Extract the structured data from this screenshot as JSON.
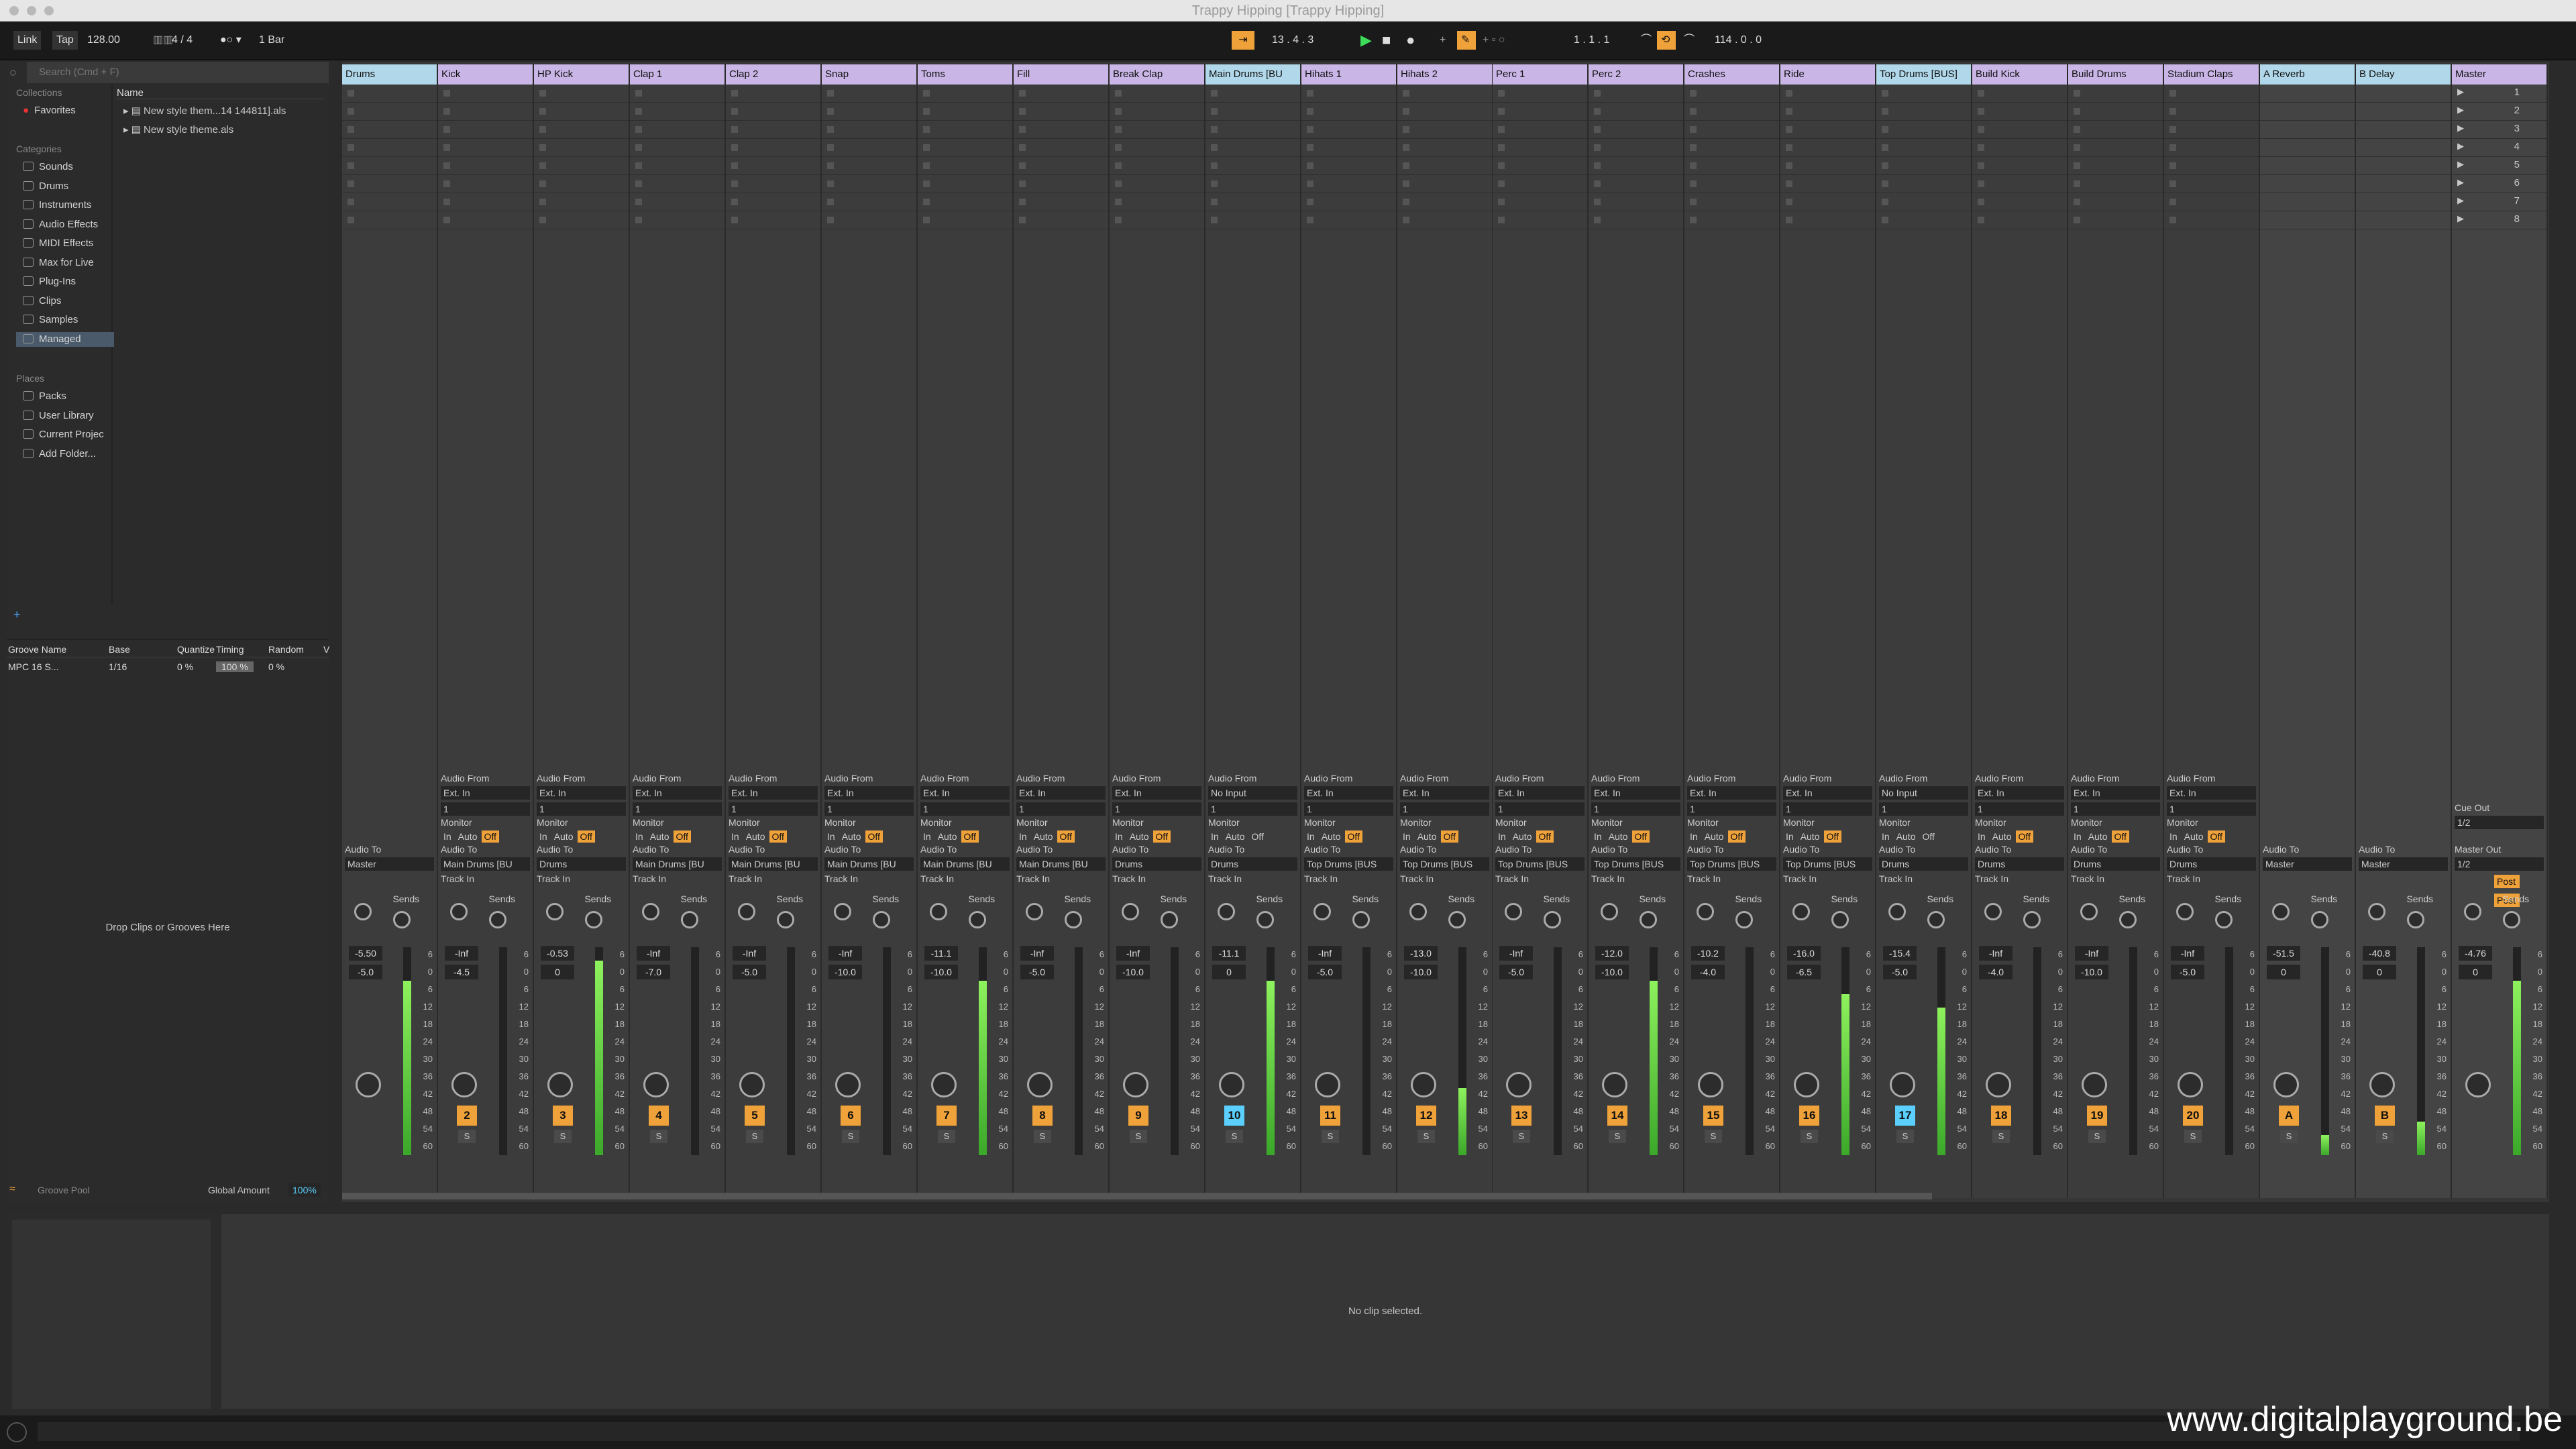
{
  "window": {
    "title": "Trappy Hipping  [Trappy Hipping]"
  },
  "toolbar": {
    "link": "Link",
    "tap": "Tap",
    "tempo": "128.00",
    "sig": "4 / 4",
    "quant": "1 Bar",
    "position": "13 .  4 .  3",
    "loop_start": "1 .  1 .  1",
    "loop_len": "114 .  0 .  0"
  },
  "browser": {
    "search_placeholder": "Search (Cmd + F)",
    "collections_label": "Collections",
    "favorites": "Favorites",
    "categories_label": "Categories",
    "categories": [
      "Sounds",
      "Drums",
      "Instruments",
      "Audio Effects",
      "MIDI Effects",
      "Max for Live",
      "Plug-Ins",
      "Clips",
      "Samples",
      "Managed"
    ],
    "places_label": "Places",
    "places": [
      "Packs",
      "User Library",
      "Current Projec",
      "Add Folder..."
    ],
    "name_header": "Name",
    "files": [
      "New style them...14 144811].als",
      "New style theme.als"
    ]
  },
  "groove": {
    "headers": [
      "Groove Name",
      "Base",
      "Quantize",
      "Timing",
      "Random",
      "V"
    ],
    "row": [
      "MPC 16 S...",
      "1/16",
      "0 %",
      "100 %",
      "0 %"
    ],
    "drop_hint": "Drop Clips or Grooves Here",
    "pool_label": "Groove Pool",
    "global_label": "Global Amount",
    "global_value": "100%"
  },
  "tracks": [
    {
      "name": "Drums",
      "num": "",
      "vol": "-5.50",
      "pan": "-5.0",
      "from": "",
      "to_label": "Audio To",
      "to": "Master",
      "color": "#b0d8ea"
    },
    {
      "name": "Kick",
      "num": "2",
      "vol": "-Inf",
      "pan": "-4.5",
      "from": "Ext. In",
      "to": "Main Drums [BU",
      "color": "#c9b5e6"
    },
    {
      "name": "HP Kick",
      "num": "3",
      "vol": "-0.53",
      "pan": "0",
      "from": "Ext. In",
      "to": "Drums",
      "color": "#c9b5e6"
    },
    {
      "name": "Clap 1",
      "num": "4",
      "vol": "-Inf",
      "pan": "-7.0",
      "from": "Ext. In",
      "to": "Main Drums [BU",
      "color": "#c9b5e6"
    },
    {
      "name": "Clap 2",
      "num": "5",
      "vol": "-Inf",
      "pan": "-5.0",
      "from": "Ext. In",
      "to": "Main Drums [BU",
      "color": "#c9b5e6"
    },
    {
      "name": "Snap",
      "num": "6",
      "vol": "-Inf",
      "pan": "-10.0",
      "from": "Ext. In",
      "to": "Main Drums [BU",
      "color": "#c9b5e6"
    },
    {
      "name": "Toms",
      "num": "7",
      "vol": "-11.1",
      "pan": "-10.0",
      "from": "Ext. In",
      "to": "Main Drums [BU",
      "color": "#c9b5e6"
    },
    {
      "name": "Fill",
      "num": "8",
      "vol": "-Inf",
      "pan": "-5.0",
      "from": "Ext. In",
      "to": "Main Drums [BU",
      "color": "#c9b5e6"
    },
    {
      "name": "Break Clap",
      "num": "9",
      "vol": "-Inf",
      "pan": "-10.0",
      "from": "Ext. In",
      "to": "Drums",
      "color": "#c9b5e6"
    },
    {
      "name": "Main Drums [BU",
      "num": "10",
      "vol": "-11.1",
      "pan": "0",
      "from": "No Input",
      "to": "Drums",
      "color": "#b0d8ea"
    },
    {
      "name": "Hihats 1",
      "num": "11",
      "vol": "-Inf",
      "pan": "-5.0",
      "from": "Ext. In",
      "to": "Top Drums [BUS",
      "color": "#c9b5e6"
    },
    {
      "name": "Hihats 2",
      "num": "12",
      "vol": "-13.0",
      "pan": "-10.0",
      "from": "Ext. In",
      "to": "Top Drums [BUS",
      "color": "#c9b5e6"
    },
    {
      "name": "Perc 1",
      "num": "13",
      "vol": "-Inf",
      "pan": "-5.0",
      "from": "Ext. In",
      "to": "Top Drums [BUS",
      "color": "#c9b5e6"
    },
    {
      "name": "Perc 2",
      "num": "14",
      "vol": "-12.0",
      "pan": "-10.0",
      "from": "Ext. In",
      "to": "Top Drums [BUS",
      "color": "#c9b5e6"
    },
    {
      "name": "Crashes",
      "num": "15",
      "vol": "-10.2",
      "pan": "-4.0",
      "from": "Ext. In",
      "to": "Top Drums [BUS",
      "color": "#c9b5e6"
    },
    {
      "name": "Ride",
      "num": "16",
      "vol": "-16.0",
      "pan": "-6.5",
      "from": "Ext. In",
      "to": "Top Drums [BUS",
      "color": "#c9b5e6"
    },
    {
      "name": "Top Drums [BUS]",
      "num": "17",
      "vol": "-15.4",
      "pan": "-5.0",
      "from": "No Input",
      "to": "Drums",
      "color": "#b0d8ea"
    },
    {
      "name": "Build Kick",
      "num": "18",
      "vol": "-Inf",
      "pan": "-4.0",
      "from": "Ext. In",
      "to": "Drums",
      "color": "#c9b5e6"
    },
    {
      "name": "Build Drums",
      "num": "19",
      "vol": "-Inf",
      "pan": "-10.0",
      "from": "Ext. In",
      "to": "Drums",
      "color": "#c9b5e6"
    },
    {
      "name": "Stadium Claps",
      "num": "20",
      "vol": "-Inf",
      "pan": "-5.0",
      "from": "Ext. In",
      "to": "Drums",
      "color": "#c9b5e6"
    },
    {
      "name": "A Reverb",
      "num": "A",
      "vol": "-51.5",
      "pan": "0",
      "from": "",
      "to_label": "Audio To",
      "to": "Master",
      "color": "#b0d8ea"
    },
    {
      "name": "B Delay",
      "num": "B",
      "vol": "-40.8",
      "pan": "0",
      "from": "",
      "to_label": "Audio To",
      "to": "Master",
      "color": "#b0d8ea"
    },
    {
      "name": "Master",
      "num": "",
      "vol": "-4.76",
      "pan": "0",
      "from": "",
      "to_label": "Master Out",
      "to": "1/2",
      "color": "#c9b5e6"
    }
  ],
  "labels": {
    "audio_from": "Audio From",
    "monitor": "Monitor",
    "in": "In",
    "auto": "Auto",
    "off": "Off",
    "audio_to": "Audio To",
    "track_in": "Track In",
    "sends": "Sends",
    "cue_out": "Cue Out",
    "cue_val": "1/2",
    "s": "S",
    "post": "Post",
    "input_ch": "1"
  },
  "scale": [
    "6",
    "0",
    "6",
    "12",
    "18",
    "24",
    "30",
    "36",
    "42",
    "48",
    "54",
    "60"
  ],
  "scenes": [
    "1",
    "2",
    "3",
    "4",
    "5",
    "6",
    "7",
    "8"
  ],
  "detail": {
    "no_clip": "No clip selected."
  },
  "watermark": "www.digitalplayground.be"
}
